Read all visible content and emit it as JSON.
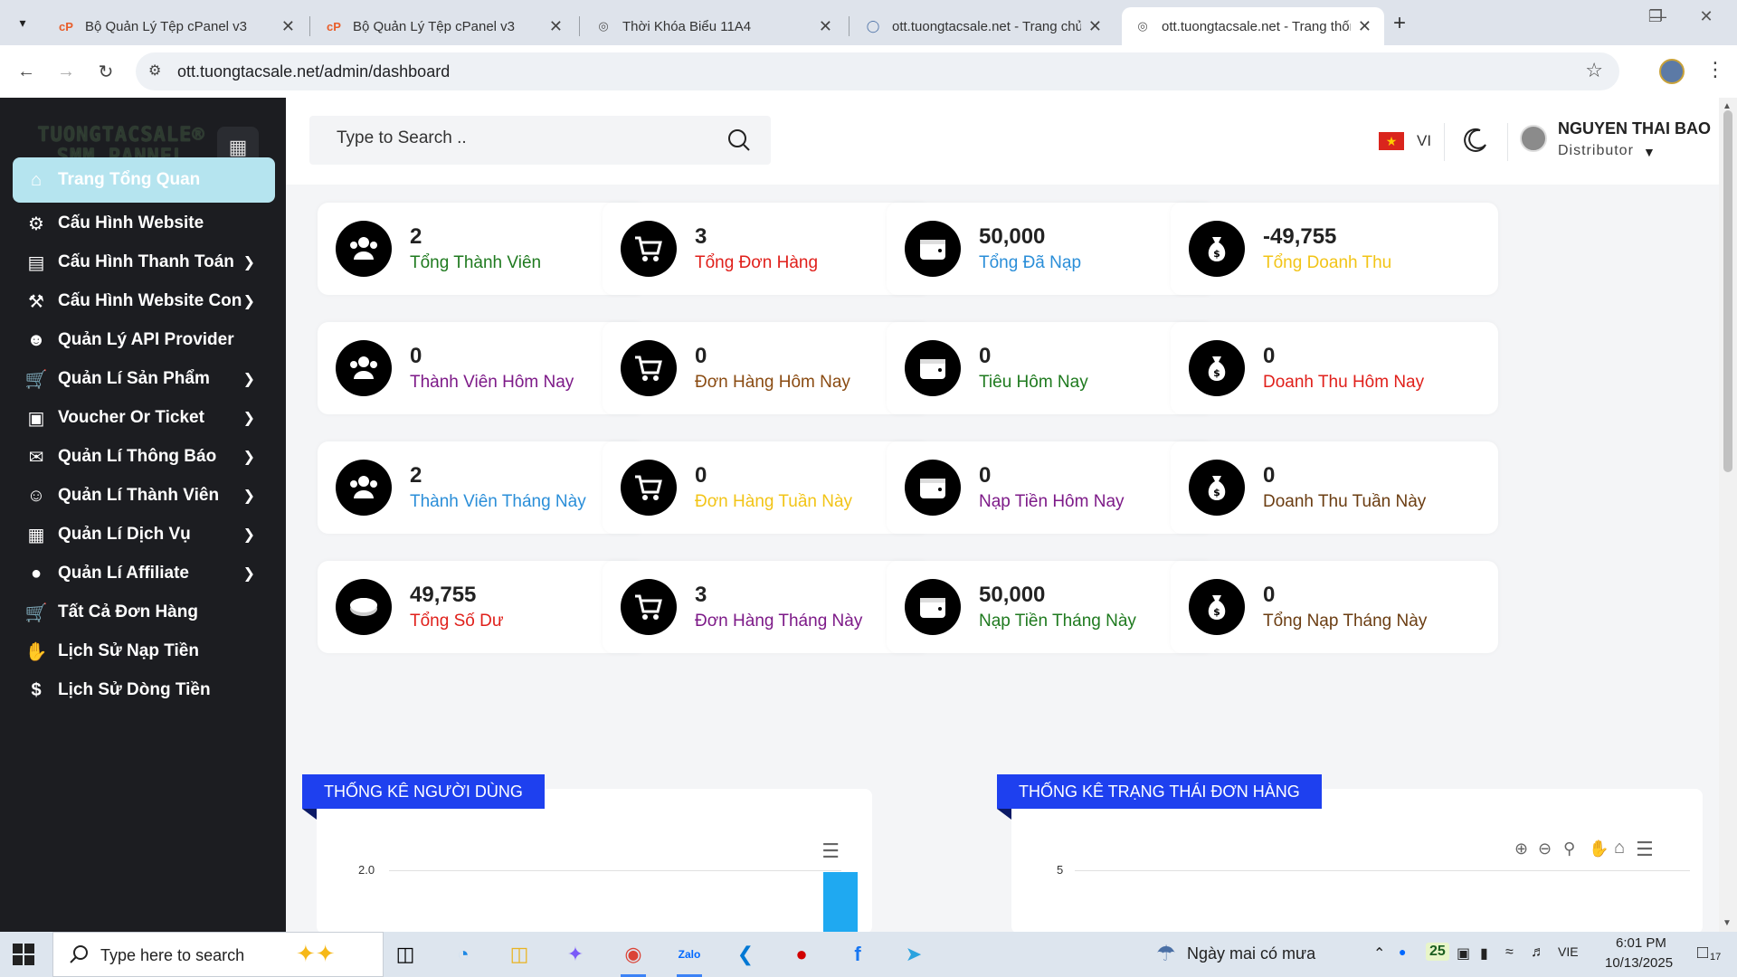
{
  "browser": {
    "tabs": [
      {
        "title": "Bộ Quản Lý Tệp cPanel v3",
        "favicon": "cpanel-icon"
      },
      {
        "title": "Bộ Quản Lý Tệp cPanel v3",
        "favicon": "cpanel-icon"
      },
      {
        "title": "Thời Khóa Biểu 11A4",
        "favicon": "globe-icon"
      },
      {
        "title": "ott.tuongtacsale.net - Trang chủ",
        "favicon": "loading-icon"
      },
      {
        "title": "ott.tuongtacsale.net - Trang thống kê",
        "favicon": "globe-icon"
      }
    ],
    "url": "ott.tuongtacsale.net/admin/dashboard"
  },
  "sidebar": {
    "brand_line1": "TUONGTACSALE®",
    "brand_line2": "SMM PANNEL",
    "items": [
      {
        "label": "Trang Tổng Quan",
        "icon": "home-icon",
        "chevron": false,
        "active": true
      },
      {
        "label": "Cấu Hình Website",
        "icon": "gears-icon",
        "chevron": false
      },
      {
        "label": "Cấu Hình Thanh Toán",
        "icon": "credit-card-icon",
        "chevron": true
      },
      {
        "label": "Cấu Hình Website Con",
        "icon": "drill-icon",
        "chevron": true
      },
      {
        "label": "Quản Lý API Provider",
        "icon": "users-gear-icon",
        "chevron": false
      },
      {
        "label": "Quản Lí Sản Phẩm",
        "icon": "cart-icon",
        "chevron": true
      },
      {
        "label": "Voucher Or Ticket",
        "icon": "ticket-icon",
        "chevron": true
      },
      {
        "label": "Quản Lí Thông Báo",
        "icon": "bullhorn-icon",
        "chevron": true
      },
      {
        "label": "Quản Lí Thành Viên",
        "icon": "user-circle-icon",
        "chevron": true
      },
      {
        "label": "Quản Lí Dịch Vụ",
        "icon": "sitemap-icon",
        "chevron": true
      },
      {
        "label": "Quản Lí Affiliate",
        "icon": "location-pin-icon",
        "chevron": true
      },
      {
        "label": "Tất Cả Đơn Hàng",
        "icon": "cart-icon",
        "chevron": false
      },
      {
        "label": "Lịch Sử Nạp Tiền",
        "icon": "hand-money-icon",
        "chevron": false
      },
      {
        "label": "Lịch Sử Dòng Tiền",
        "icon": "dollar-hand-icon",
        "chevron": false
      }
    ]
  },
  "topbar": {
    "search_placeholder": "Type to Search ..",
    "lang": "VI",
    "user_name": "NGUYEN THAI BAO",
    "user_role": "Distributor"
  },
  "cards": [
    {
      "value": "2",
      "label": "Tổng Thành Viên",
      "color": "#1f7a1f",
      "icon": "users"
    },
    {
      "value": "3",
      "label": "Tổng Đơn Hàng",
      "color": "#e0201b",
      "icon": "cart"
    },
    {
      "value": "50,000",
      "label": "Tổng Đã Nạp",
      "color": "#2a8ed8",
      "icon": "wallet"
    },
    {
      "value": "-49,755",
      "label": "Tổng Doanh Thu",
      "color": "#f2c417",
      "icon": "moneybag"
    },
    {
      "value": "0",
      "label": "Thành Viên Hôm Nay",
      "color": "#7d1a88",
      "icon": "users"
    },
    {
      "value": "0",
      "label": "Đơn Hàng Hôm Nay",
      "color": "#8a4b12",
      "icon": "cart"
    },
    {
      "value": "0",
      "label": "Tiêu Hôm Nay",
      "color": "#1f7a1f",
      "icon": "wallet"
    },
    {
      "value": "0",
      "label": "Doanh Thu Hôm Nay",
      "color": "#e0201b",
      "icon": "moneybag"
    },
    {
      "value": "2",
      "label": "Thành Viên Tháng Này",
      "color": "#2a8ed8",
      "icon": "users"
    },
    {
      "value": "0",
      "label": "Đơn Hàng Tuần Này",
      "color": "#f2c417",
      "icon": "cart"
    },
    {
      "value": "0",
      "label": "Nạp Tiền Hôm Nay",
      "color": "#7d1a88",
      "icon": "wallet"
    },
    {
      "value": "0",
      "label": "Doanh Thu Tuần Này",
      "color": "#6b3d12",
      "icon": "moneybag"
    },
    {
      "value": "49,755",
      "label": "Tổng Số Dư",
      "color": "#e0201b",
      "icon": "coin"
    },
    {
      "value": "3",
      "label": "Đơn Hàng Tháng Này",
      "color": "#7d1a88",
      "icon": "cart"
    },
    {
      "value": "50,000",
      "label": "Nạp Tiền Tháng Này",
      "color": "#1f7a1f",
      "icon": "wallet"
    },
    {
      "value": "0",
      "label": "Tổng Nạp Tháng Này",
      "color": "#6b3d12",
      "icon": "moneybag"
    }
  ],
  "panels": {
    "users_title": "THỐNG KÊ NGƯỜI DÙNG",
    "users_ytick": "2.0",
    "orders_title": "THỐNG KÊ TRẠNG THÁI ĐƠN HÀNG",
    "orders_ytick": "5"
  },
  "taskbar": {
    "search_placeholder": "Type here to search",
    "weather": "Ngày mai có mưa",
    "tray_badge": "25",
    "lang": "VIE",
    "time": "6:01 PM",
    "date": "10/13/2025",
    "notif_count": "17"
  }
}
